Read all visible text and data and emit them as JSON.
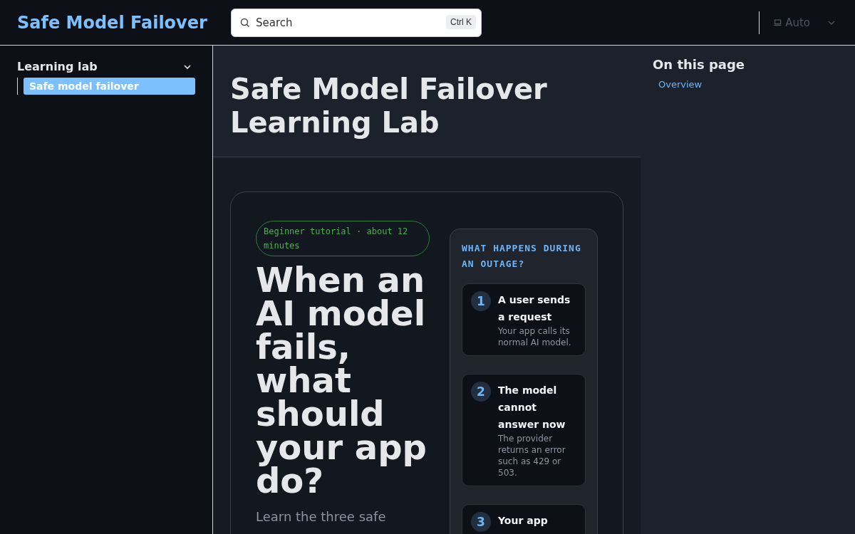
{
  "header": {
    "site_title": "Safe Model Failover",
    "search": {
      "placeholder": "Search",
      "shortcut": "Ctrl K"
    },
    "theme": {
      "label": "Auto"
    }
  },
  "sidebar": {
    "group": {
      "label": "Learning lab",
      "expanded": true
    },
    "items": [
      {
        "label": "Safe model failover",
        "selected": true
      }
    ]
  },
  "page": {
    "title": "Safe Model Failover Learning Lab"
  },
  "hero": {
    "badge": "Beginner tutorial · about 12 minutes",
    "heading": "When an AI model fails, what should your app do?",
    "lead": "Learn the three safe",
    "panel": {
      "title": "WHAT HAPPENS DURING AN OUTAGE?",
      "steps": [
        {
          "number": "1",
          "title": "A user sends a request",
          "text": "Your app calls its normal AI model."
        },
        {
          "number": "2",
          "title": "The model cannot answer now",
          "text": "The provider returns an error such as 429 or 503."
        },
        {
          "number": "3",
          "title": "Your app"
        }
      ]
    }
  },
  "toc": {
    "title": "On this page",
    "items": [
      {
        "label": "Overview",
        "selected": false
      }
    ]
  }
}
